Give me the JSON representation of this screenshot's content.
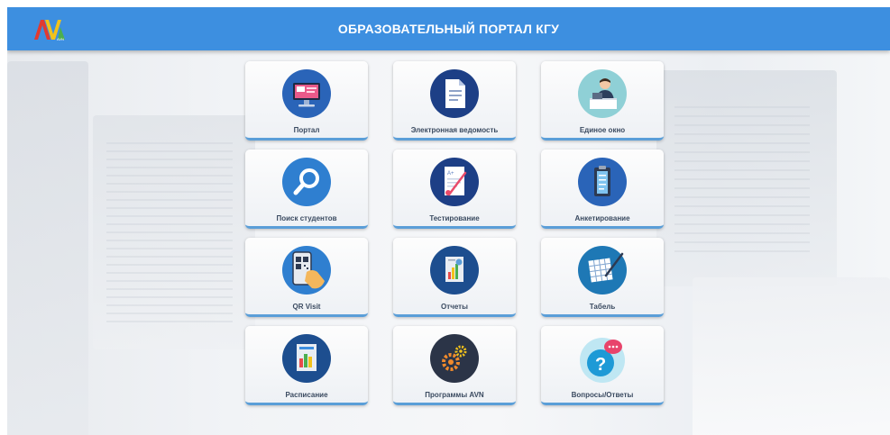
{
  "header": {
    "title": "ОБРАЗОВАТЕЛЬНЫЙ ПОРТАЛ КГУ",
    "logo_text": "AVN",
    "color": "#3d8fe0"
  },
  "tiles": [
    {
      "label": "Портал",
      "icon": "monitor-icon"
    },
    {
      "label": "Электронная ведомость",
      "icon": "document-icon"
    },
    {
      "label": "Единое окно",
      "icon": "clerk-desk-icon"
    },
    {
      "label": "Поиск студентов",
      "icon": "search-icon"
    },
    {
      "label": "Тестирование",
      "icon": "test-sheet-icon"
    },
    {
      "label": "Анкетирование",
      "icon": "clipboard-icon"
    },
    {
      "label": "QR Visit",
      "icon": "qr-phone-icon"
    },
    {
      "label": "Отчеты",
      "icon": "report-icon"
    },
    {
      "label": "Табель",
      "icon": "spreadsheet-pen-icon"
    },
    {
      "label": "Расписание",
      "icon": "schedule-icon"
    },
    {
      "label": "Программы AVN",
      "icon": "gears-icon"
    },
    {
      "label": "Вопросы/Ответы",
      "icon": "question-chat-icon"
    }
  ]
}
